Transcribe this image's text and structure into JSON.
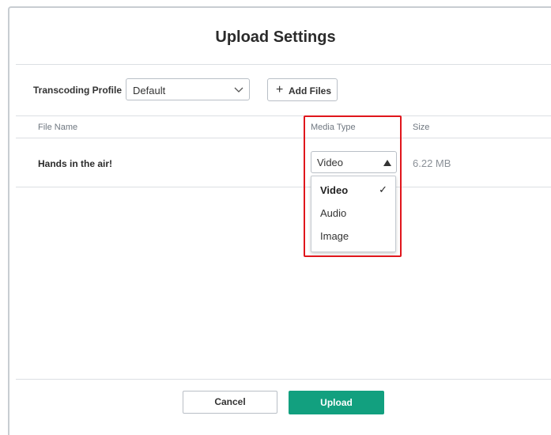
{
  "dialog": {
    "title": "Upload Settings"
  },
  "toolbar": {
    "profile_label": "Transcoding Profile",
    "profile_value": "Default",
    "add_files_label": "Add Files"
  },
  "table": {
    "headers": [
      "File Name",
      "Media Type",
      "Size"
    ],
    "rows": [
      {
        "name": "Hands in the air!",
        "media_type": "Video",
        "size": "6.22 MB"
      }
    ]
  },
  "media_type_menu": {
    "options": [
      "Video",
      "Audio",
      "Image"
    ],
    "selected": "Video"
  },
  "footer": {
    "cancel_label": "Cancel",
    "upload_label": "Upload"
  },
  "colors": {
    "accent": "#12a07f",
    "highlight": "#e0161c"
  },
  "icons": {
    "profile_dropdown": "chevron-down-icon",
    "media_type_dropdown": "caret-up-icon",
    "add_files": "plus-icon",
    "selected_option": "check-icon"
  }
}
